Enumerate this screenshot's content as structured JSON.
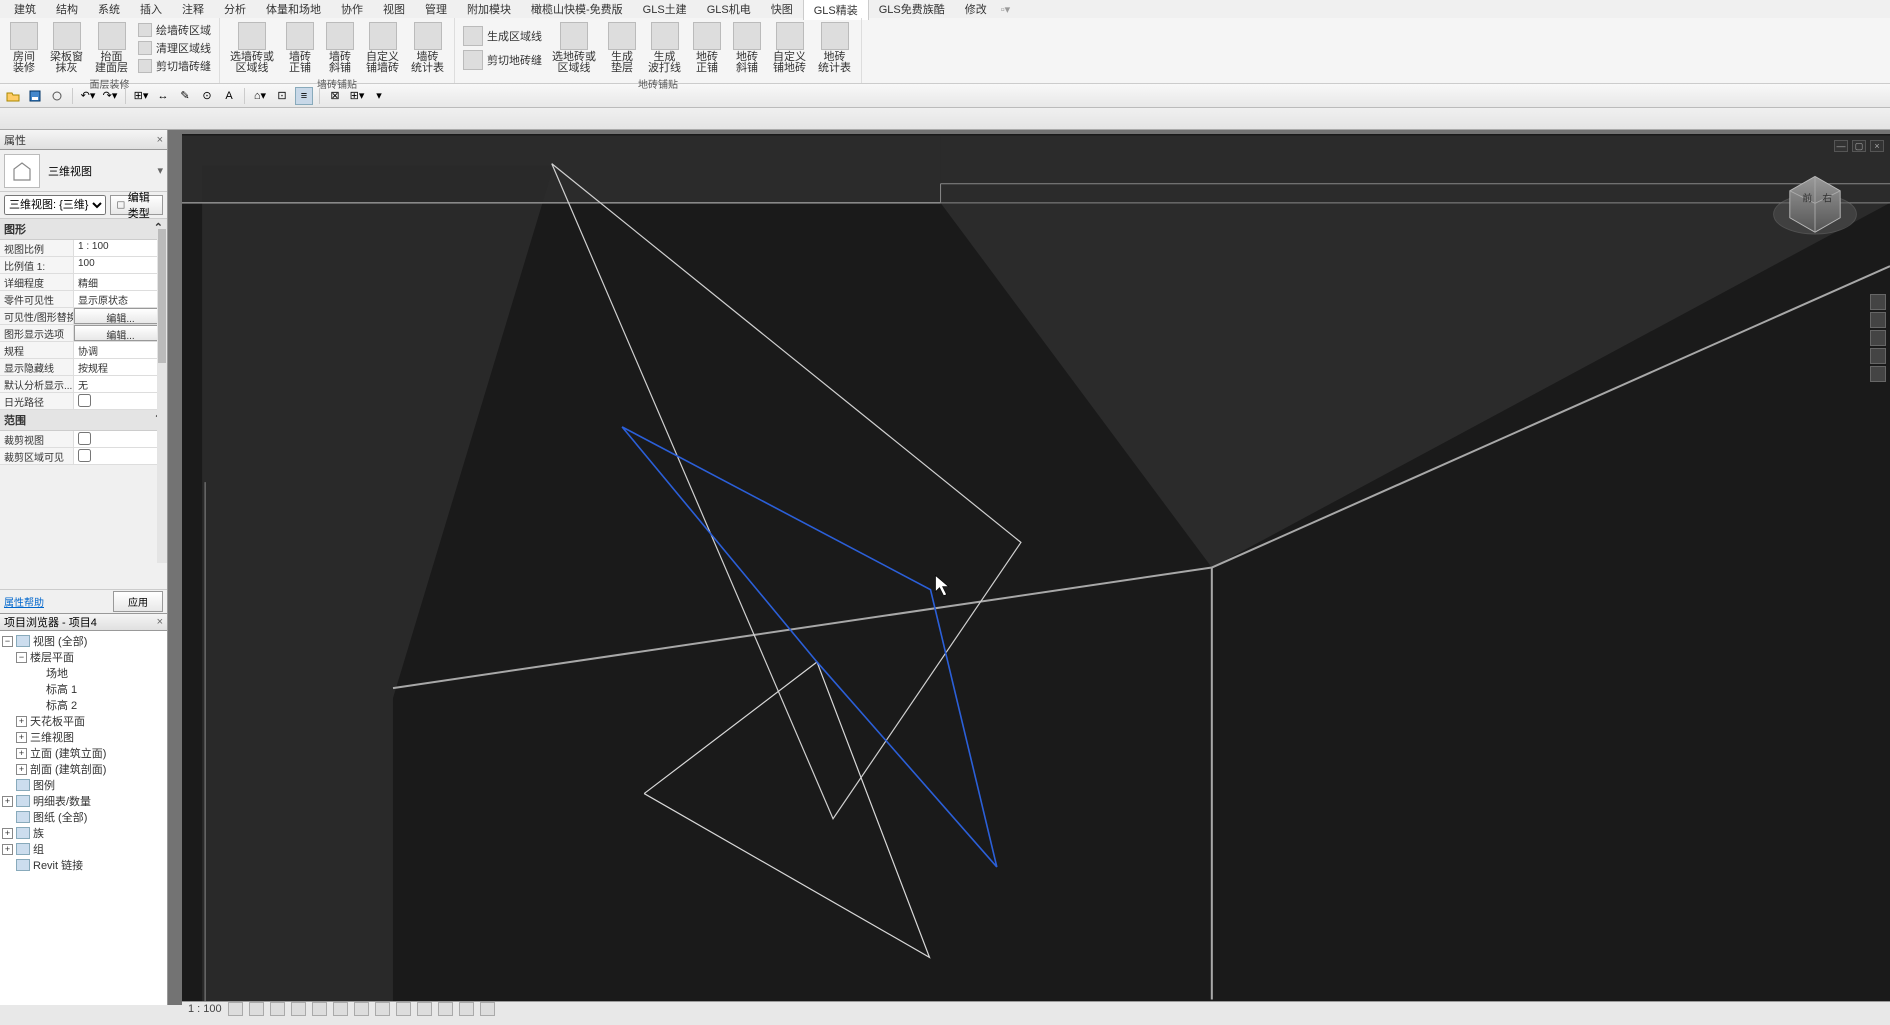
{
  "menu": {
    "items": [
      "建筑",
      "结构",
      "系统",
      "插入",
      "注释",
      "分析",
      "体量和场地",
      "协作",
      "视图",
      "管理",
      "附加模块",
      "橄榄山快模-免费版",
      "GLS土建",
      "GLS机电",
      "快图",
      "GLS精装",
      "GLS免费族酷",
      "修改"
    ],
    "active_index": 15
  },
  "ribbon": {
    "groups": [
      {
        "label": "面层装修",
        "big": [
          {
            "label1": "房间",
            "label2": "装修"
          },
          {
            "label1": "梁板窗",
            "label2": "抹灰"
          },
          {
            "label1": "抬面",
            "label2": "建面层"
          }
        ],
        "small": [
          {
            "label": "绘墙砖区域"
          },
          {
            "label": "清理区域线"
          },
          {
            "label": "剪切墙砖缝"
          }
        ]
      },
      {
        "label": "墙砖铺贴",
        "big": [
          {
            "label1": "选墙砖或",
            "label2": "区域线"
          },
          {
            "label1": "墙砖",
            "label2": "正铺"
          },
          {
            "label1": "墙砖",
            "label2": "斜铺"
          },
          {
            "label1": "自定义",
            "label2": "铺墙砖"
          },
          {
            "label1": "墙砖",
            "label2": "统计表"
          }
        ]
      },
      {
        "label": "地砖铺贴",
        "big2": [
          {
            "label1": "生成区域线"
          },
          {
            "label1": "剪切地砖缝"
          }
        ],
        "big": [
          {
            "label1": "选地砖或",
            "label2": "区域线"
          },
          {
            "label1": "生成",
            "label2": "垫层"
          },
          {
            "label1": "生成",
            "label2": "波打线"
          },
          {
            "label1": "地砖",
            "label2": "正铺"
          },
          {
            "label1": "地砖",
            "label2": "斜铺"
          },
          {
            "label1": "自定义",
            "label2": "铺地砖"
          },
          {
            "label1": "地砖",
            "label2": "统计表"
          }
        ]
      }
    ]
  },
  "properties": {
    "title": "属性",
    "type_label": "三维视图",
    "selector": "三维视图: {三维}",
    "edit_type": "编辑类型",
    "cat1": "图形",
    "rows1": [
      {
        "l": "视图比例",
        "v": "1 : 100"
      },
      {
        "l": "比例值 1:",
        "v": "100"
      },
      {
        "l": "详细程度",
        "v": "精细"
      },
      {
        "l": "零件可见性",
        "v": "显示原状态"
      },
      {
        "l": "可见性/图形替换",
        "v": "编辑...",
        "btn": true
      },
      {
        "l": "图形显示选项",
        "v": "编辑...",
        "btn": true
      },
      {
        "l": "规程",
        "v": "协调"
      },
      {
        "l": "显示隐藏线",
        "v": "按规程"
      },
      {
        "l": "默认分析显示...",
        "v": "无"
      },
      {
        "l": "日光路径",
        "v": "",
        "chk": true
      }
    ],
    "cat2": "范围",
    "rows2": [
      {
        "l": "裁剪视图",
        "v": "",
        "chk": true
      },
      {
        "l": "裁剪区域可见",
        "v": "",
        "chk": true
      }
    ],
    "help": "属性帮助",
    "apply": "应用"
  },
  "browser": {
    "title": "项目浏览器 - 项目4",
    "nodes": [
      {
        "d": 0,
        "exp": "−",
        "icon": true,
        "label": "视图 (全部)"
      },
      {
        "d": 1,
        "exp": "−",
        "label": "楼层平面"
      },
      {
        "d": 2,
        "label": "场地"
      },
      {
        "d": 2,
        "label": "标高 1"
      },
      {
        "d": 2,
        "label": "标高 2"
      },
      {
        "d": 1,
        "exp": "+",
        "label": "天花板平面"
      },
      {
        "d": 1,
        "exp": "+",
        "label": "三维视图"
      },
      {
        "d": 1,
        "exp": "+",
        "label": "立面 (建筑立面)"
      },
      {
        "d": 1,
        "exp": "+",
        "label": "剖面 (建筑剖面)"
      },
      {
        "d": 0,
        "icon": true,
        "label": "图例"
      },
      {
        "d": 0,
        "exp": "+",
        "icon": true,
        "label": "明细表/数量"
      },
      {
        "d": 0,
        "icon": true,
        "label": "图纸 (全部)"
      },
      {
        "d": 0,
        "exp": "+",
        "icon": true,
        "label": "族"
      },
      {
        "d": 0,
        "exp": "+",
        "icon": true,
        "label": "组"
      },
      {
        "d": 0,
        "icon": true,
        "label": "Revit 链接"
      }
    ]
  },
  "viewstatus": {
    "scale": "1 : 100"
  }
}
